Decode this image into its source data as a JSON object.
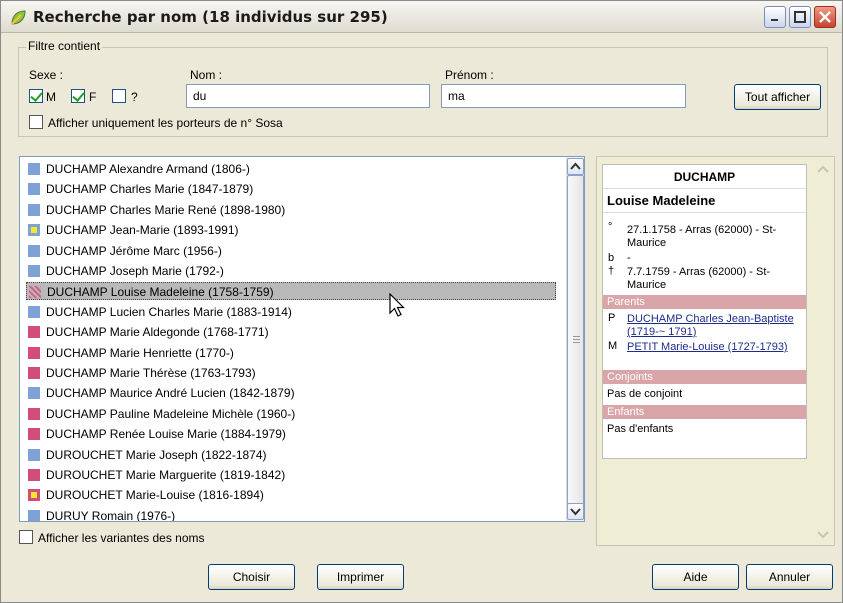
{
  "window": {
    "title": "Recherche par nom (18 individus sur 295)"
  },
  "filter": {
    "legend": "Filtre contient",
    "sexe_label": "Sexe :",
    "sexe_options": [
      {
        "label": "M",
        "checked": true
      },
      {
        "label": "F",
        "checked": true
      },
      {
        "label": "?",
        "checked": false
      }
    ],
    "nom_label": "Nom :",
    "nom_value": "du",
    "prenom_label": "Prénom :",
    "prenom_value": "ma",
    "sosa_label": "Afficher uniquement les porteurs de n° Sosa",
    "tout_afficher": "Tout afficher"
  },
  "list": {
    "items": [
      {
        "label": "DUCHAMP Alexandre Armand (1806-)",
        "marker": "m"
      },
      {
        "label": "DUCHAMP Charles Marie (1847-1879)",
        "marker": "m"
      },
      {
        "label": "DUCHAMP Charles Marie René (1898-1980)",
        "marker": "m"
      },
      {
        "label": "DUCHAMP Jean-Marie (1893-1991)",
        "marker": "my"
      },
      {
        "label": "DUCHAMP Jérôme Marc (1956-)",
        "marker": "m"
      },
      {
        "label": "DUCHAMP Joseph Marie (1792-)",
        "marker": "m"
      },
      {
        "label": "DUCHAMP Louise Madeleine (1758-1759)",
        "marker": "sel",
        "selected": true
      },
      {
        "label": "DUCHAMP Lucien Charles Marie (1883-1914)",
        "marker": "m"
      },
      {
        "label": "DUCHAMP Marie Aldegonde (1768-1771)",
        "marker": "f"
      },
      {
        "label": "DUCHAMP Marie Henriette (1770-)",
        "marker": "f"
      },
      {
        "label": "DUCHAMP Marie Thérèse (1763-1793)",
        "marker": "f"
      },
      {
        "label": "DUCHAMP Maurice André Lucien (1842-1879)",
        "marker": "m"
      },
      {
        "label": "DUCHAMP Pauline Madeleine Michèle (1960-)",
        "marker": "f"
      },
      {
        "label": "DUCHAMP Renée Louise Marie (1884-1979)",
        "marker": "f"
      },
      {
        "label": "DUROUCHET Marie Joseph (1822-1874)",
        "marker": "m"
      },
      {
        "label": "DUROUCHET Marie Marguerite (1819-1842)",
        "marker": "f"
      },
      {
        "label": "DUROUCHET Marie-Louise (1816-1894)",
        "marker": "fy"
      },
      {
        "label": "DURUY Romain (1976-)",
        "marker": "m"
      }
    ]
  },
  "detail": {
    "surname": "DUCHAMP",
    "given_names": "Louise Madeleine",
    "birth_key": "°",
    "birth": "27.1.1758 - Arras (62000) - St-Maurice",
    "baptism_key": "b",
    "baptism": "-",
    "death_key": "†",
    "death": "7.7.1759 - Arras (62000) - St-Maurice",
    "parents_header": "Parents",
    "father_key": "P",
    "father": "DUCHAMP Charles Jean-Baptiste (1719-~ 1791)",
    "mother_key": "M",
    "mother": "PETIT Marie-Louise (1727-1793)",
    "spouses_header": "Conjoints",
    "spouses": "Pas de conjoint",
    "children_header": "Enfants",
    "children": "Pas d'enfants"
  },
  "variants_label": "Afficher les variantes des noms",
  "buttons": {
    "choisir": "Choisir",
    "imprimer": "Imprimer",
    "aide": "Aide",
    "annuler": "Annuler"
  },
  "colors": {
    "male": "#7ea1d6",
    "female": "#d24d7b",
    "section": "#d9a5a8"
  }
}
